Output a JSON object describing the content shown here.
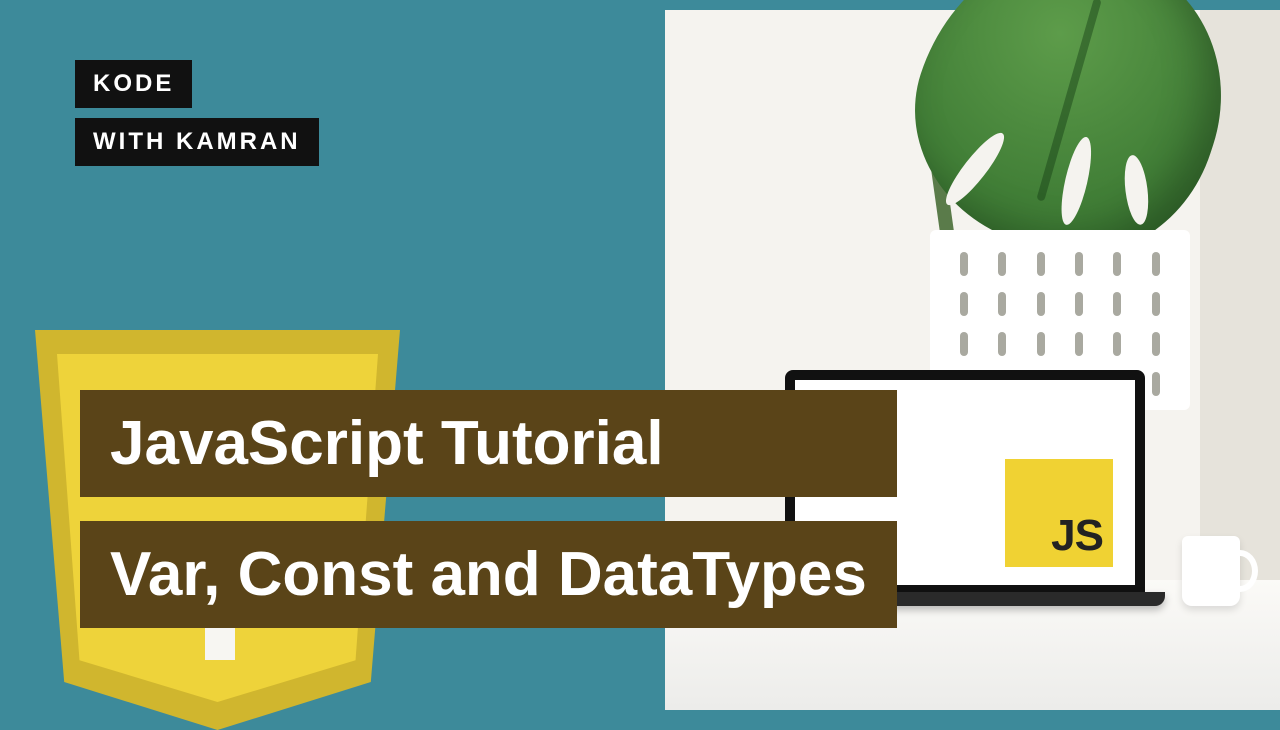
{
  "brand": {
    "line1": "KODE",
    "line2": "WITH KAMRAN"
  },
  "headline": {
    "title": "JavaScript Tutorial",
    "subtitle": "Var, Const and DataTypes"
  },
  "badge": {
    "label": "JS"
  }
}
